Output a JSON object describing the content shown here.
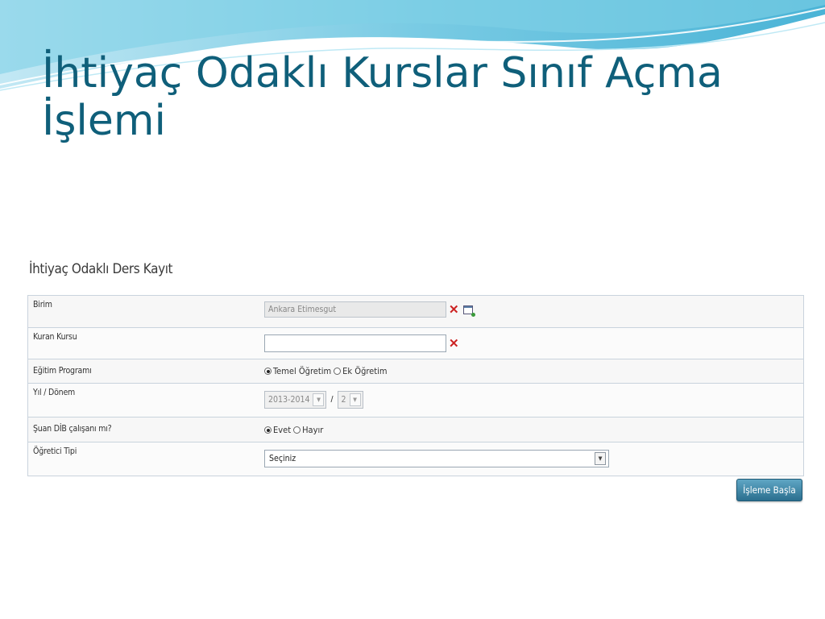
{
  "slide": {
    "title_line1": "İhtiyaç Odaklı Kurslar Sınıf Açma",
    "title_line2": "İşlemi"
  },
  "panel": {
    "title": "İhtiyaç Odaklı Ders Kayıt"
  },
  "form": {
    "birim": {
      "label": "Birim",
      "value": "Ankara Etimesgut"
    },
    "kuran_kursu": {
      "label": "Kuran Kursu",
      "value": ""
    },
    "egitim_programi": {
      "label": "Eğitim Programı",
      "options": [
        "Temel Öğretim",
        "Ek Öğretim"
      ],
      "selected": "Temel Öğretim"
    },
    "yil_donem": {
      "label": "Yıl / Dönem",
      "year": "2013-2014",
      "separator": "/",
      "term": "2"
    },
    "dib_calisani": {
      "label": "Şuan DİB çalışanı mı?",
      "options": [
        "Evet",
        "Hayır"
      ],
      "selected": "Evet"
    },
    "ogretici_tipi": {
      "label": "Öğretici Tipi",
      "value": "Seçiniz"
    }
  },
  "actions": {
    "start_button": "İşleme Başla"
  },
  "icons": {
    "clear": "x-icon",
    "select": "select-window-icon",
    "dropdown": "chevron-down-icon"
  },
  "colors": {
    "title": "#0f5f7a",
    "button": "#2b6f8f",
    "clear_icon": "#cc2222"
  }
}
